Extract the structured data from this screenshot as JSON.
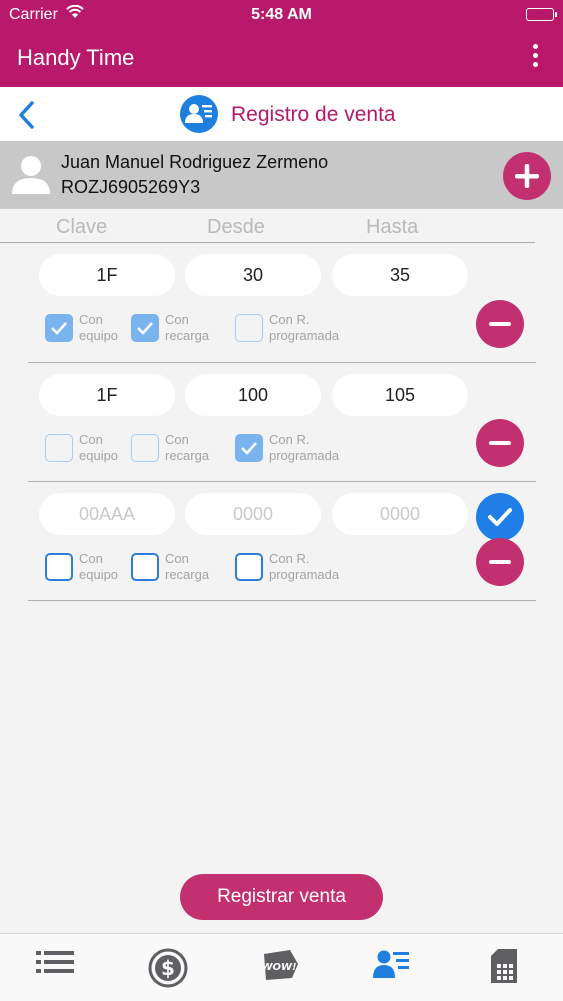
{
  "status_bar": {
    "carrier": "Carrier",
    "time": "5:48 AM"
  },
  "app": {
    "title": "Handy Time"
  },
  "nav": {
    "title": "Registro de venta"
  },
  "client": {
    "name": "Juan Manuel Rodriguez Zermeno",
    "rfc": "ROZJ6905269Y3"
  },
  "columns": {
    "clave": "Clave",
    "desde": "Desde",
    "hasta": "Hasta"
  },
  "labels": {
    "con": "Con",
    "equipo": "equipo",
    "recarga": "recarga",
    "con_r": "Con R.",
    "programada": "programada"
  },
  "rows": [
    {
      "clave": "1F",
      "desde": "30",
      "hasta": "35",
      "con_equipo": true,
      "con_recarga": true,
      "con_r_programada": false
    },
    {
      "clave": "1F",
      "desde": "100",
      "hasta": "105",
      "con_equipo": false,
      "con_recarga": false,
      "con_r_programada": true
    },
    {
      "clave": "",
      "desde": "",
      "hasta": "",
      "con_equipo": false,
      "con_recarga": false,
      "con_r_programada": false
    }
  ],
  "new_row_placeholders": {
    "clave": "00AAA",
    "desde": "0000",
    "hasta": "0000"
  },
  "actions": {
    "register": "Registrar venta"
  },
  "tabs": [
    {
      "icon": "list-icon"
    },
    {
      "icon": "dollar-coin-icon"
    },
    {
      "icon": "wow-tag-icon"
    },
    {
      "icon": "client-card-icon",
      "active": true
    },
    {
      "icon": "sim-card-icon"
    }
  ],
  "colors": {
    "brand": "#b8196a",
    "accent": "#c2306f",
    "blue": "#1f7fe6",
    "checkbox_on": "#79b4ef"
  }
}
